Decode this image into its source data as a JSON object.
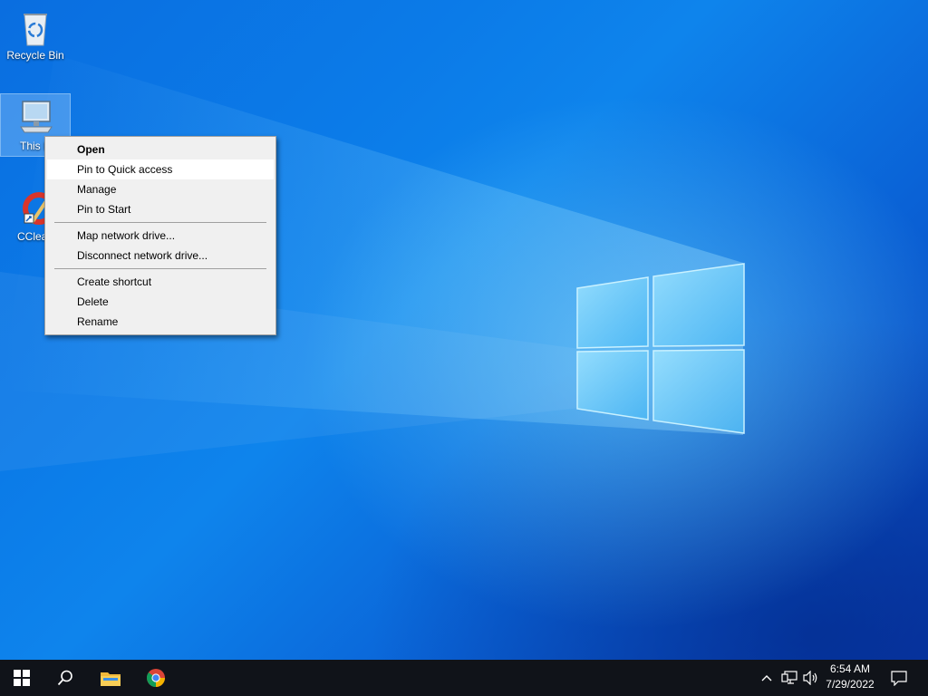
{
  "desktop": {
    "icons": [
      {
        "label": "Recycle Bin"
      },
      {
        "label": "This P"
      },
      {
        "label": "CClean"
      }
    ]
  },
  "context_menu": {
    "groups": [
      [
        {
          "label": "Open",
          "default": true
        },
        {
          "label": "Pin to Quick access",
          "highlighted": true
        },
        {
          "label": "Manage"
        },
        {
          "label": "Pin to Start"
        }
      ],
      [
        {
          "label": "Map network drive..."
        },
        {
          "label": "Disconnect network drive..."
        }
      ],
      [
        {
          "label": "Create shortcut"
        },
        {
          "label": "Delete"
        },
        {
          "label": "Rename"
        }
      ]
    ]
  },
  "taskbar": {
    "pinned": [
      {
        "icon": "windows-start-icon"
      },
      {
        "icon": "search-icon"
      },
      {
        "icon": "file-explorer-icon"
      },
      {
        "icon": "chrome-icon"
      }
    ],
    "tray_icons": [
      "chevron-up-icon",
      "network-icon",
      "volume-icon"
    ],
    "clock": {
      "time": "6:54 AM",
      "date": "7/29/2022"
    },
    "notifications_icon": "action-center-icon"
  },
  "colors": {
    "taskbar": "#101319",
    "menu_background": "#f0f0f0",
    "menu_highlight": "#ffffff",
    "wallpaper_accent": "#0a6ee0"
  }
}
